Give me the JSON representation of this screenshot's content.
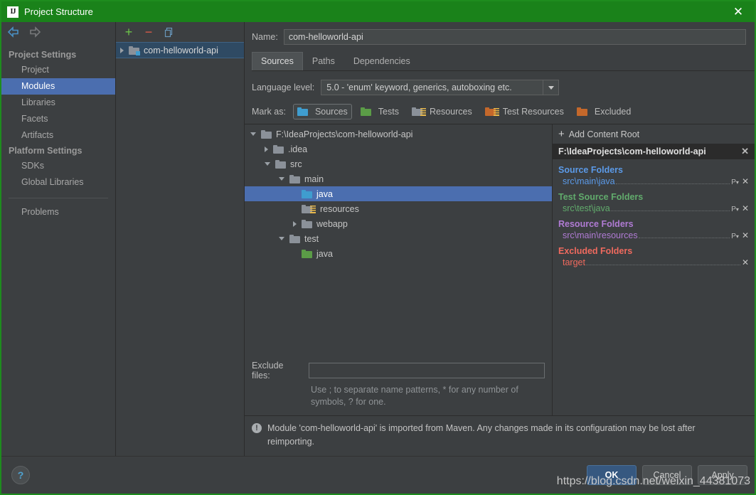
{
  "window": {
    "title": "Project Structure",
    "app_icon": "IJ",
    "close_label": "✕"
  },
  "sidebar": {
    "back_icon": "back-arrow-icon",
    "forward_icon": "forward-arrow-icon",
    "groups": [
      {
        "title": "Project Settings",
        "items": [
          {
            "label": "Project",
            "selected": false
          },
          {
            "label": "Modules",
            "selected": true
          },
          {
            "label": "Libraries",
            "selected": false
          },
          {
            "label": "Facets",
            "selected": false
          },
          {
            "label": "Artifacts",
            "selected": false
          }
        ]
      },
      {
        "title": "Platform Settings",
        "items": [
          {
            "label": "SDKs",
            "selected": false
          },
          {
            "label": "Global Libraries",
            "selected": false
          }
        ]
      }
    ],
    "problems_label": "Problems"
  },
  "modules_panel": {
    "toolbar": {
      "add_label": "+",
      "remove_label": "−",
      "copy_label": "copy-icon"
    },
    "items": [
      {
        "label": "com-helloworld-api",
        "selected": true,
        "expandable": true
      }
    ]
  },
  "form": {
    "name_label": "Name:",
    "name_value": "com-helloworld-api",
    "tabs": [
      {
        "label": "Sources",
        "active": true
      },
      {
        "label": "Paths",
        "active": false
      },
      {
        "label": "Dependencies",
        "active": false
      }
    ],
    "language_level_label": "Language level:",
    "language_level_value": "5.0 - 'enum' keyword, generics, autoboxing etc.",
    "mark_as_label": "Mark as:",
    "mark_buttons": [
      {
        "label": "Sources",
        "active": true,
        "color": "#3f9dcf"
      },
      {
        "label": "Tests",
        "active": false,
        "color": "#5b9c47"
      },
      {
        "label": "Resources",
        "active": false,
        "color": "#8b9199"
      },
      {
        "label": "Test Resources",
        "active": false,
        "color": "#c4682b"
      },
      {
        "label": "Excluded",
        "active": false,
        "color": "#c4682b"
      }
    ]
  },
  "tree": {
    "rows": [
      {
        "label": "F:\\IdeaProjects\\com-helloworld-api",
        "depth": 0,
        "arrow": "down",
        "folder": "gray",
        "selected": false
      },
      {
        "label": ".idea",
        "depth": 1,
        "arrow": "right",
        "folder": "gray",
        "selected": false
      },
      {
        "label": "src",
        "depth": 1,
        "arrow": "down",
        "folder": "gray",
        "selected": false
      },
      {
        "label": "main",
        "depth": 2,
        "arrow": "down",
        "folder": "gray",
        "selected": false
      },
      {
        "label": "java",
        "depth": 3,
        "arrow": "none",
        "folder": "blue",
        "selected": true
      },
      {
        "label": "resources",
        "depth": 3,
        "arrow": "none",
        "folder": "resource",
        "selected": false
      },
      {
        "label": "webapp",
        "depth": 2,
        "arrow": "right",
        "folder": "gray",
        "selected": false
      },
      {
        "label": "test",
        "depth": 2,
        "arrow": "down",
        "folder": "gray",
        "selected": false
      },
      {
        "label": "java",
        "depth": 3,
        "arrow": "none",
        "folder": "green",
        "selected": false
      }
    ]
  },
  "exclude": {
    "label": "Exclude files:",
    "value": "",
    "hint": "Use ; to separate name patterns, * for any number of symbols, ? for one."
  },
  "roots": {
    "add_label": "Add Content Root",
    "add_icon": "plus-icon",
    "root_path": "F:\\IdeaProjects\\com-helloworld-api",
    "root_remove_icon": "✕",
    "groups": [
      {
        "kind": "src",
        "title": "Source Folders",
        "color": "#5b9ae8",
        "folders": [
          {
            "path": "src\\main\\java",
            "has_package_prefix": true,
            "remove_icon": "✕"
          }
        ]
      },
      {
        "kind": "test",
        "title": "Test Source Folders",
        "color": "#61ab6c",
        "folders": [
          {
            "path": "src\\test\\java",
            "has_package_prefix": true,
            "remove_icon": "✕"
          }
        ]
      },
      {
        "kind": "res",
        "title": "Resource Folders",
        "color": "#b07bd4",
        "folders": [
          {
            "path": "src\\main\\resources",
            "has_package_prefix": true,
            "remove_icon": "✕"
          }
        ]
      },
      {
        "kind": "exc",
        "title": "Excluded Folders",
        "color": "#f06a5e",
        "folders": [
          {
            "path": "target",
            "has_package_prefix": false,
            "remove_icon": "✕"
          }
        ]
      }
    ],
    "package_prefix_icon": "P"
  },
  "message": {
    "icon": "warning-icon",
    "text": "Module 'com-helloworld-api' is imported from Maven. Any changes made in its configuration may be lost after reimporting."
  },
  "bottom": {
    "help_label": "?",
    "ok_label": "OK",
    "cancel_label": "Cancel",
    "apply_label": "Apply",
    "watermark": "https://blog.csdn.net/weixin_44381073"
  },
  "colors": {
    "title_bar": "#1a821a",
    "selection": "#4b6eaf",
    "primary_button": "#365880",
    "background": "#3c3f41"
  }
}
